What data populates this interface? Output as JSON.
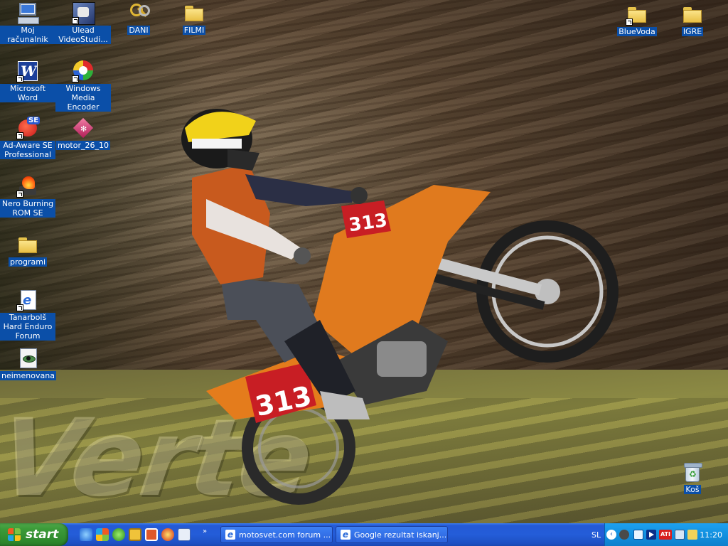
{
  "desktop": {
    "icons_left": [
      {
        "label": "Moj računalnik",
        "icon": "my-computer-icon"
      },
      {
        "label": "Ulead VideoStudi...",
        "icon": "ulead-videostudio-icon",
        "shortcut": true
      },
      {
        "label": "DANI",
        "icon": "keys-icon"
      },
      {
        "label": "FILMI",
        "icon": "folder-icon"
      },
      {
        "label": "Microsoft Word",
        "icon": "word-icon",
        "shortcut": true
      },
      {
        "label": "Windows Media Encoder",
        "icon": "media-encoder-icon",
        "shortcut": true
      },
      {
        "label": "Ad-Aware SE Professional",
        "icon": "adaware-icon",
        "shortcut": true
      },
      {
        "label": "motor_26_10",
        "icon": "image-file-icon"
      },
      {
        "label": "Nero Burning ROM SE",
        "icon": "nero-icon",
        "shortcut": true
      },
      {
        "label": "programi",
        "icon": "folder-icon"
      },
      {
        "label": "Tanarbolš Hard Enduro Forum",
        "icon": "ie-shortcut-icon"
      },
      {
        "label": "neimenovana",
        "icon": "jpeg-file-icon"
      }
    ],
    "icons_right": [
      {
        "label": "BlueVoda",
        "icon": "folder-shortcut-icon",
        "shortcut": true
      },
      {
        "label": "IGRE",
        "icon": "folder-icon"
      },
      {
        "label": "Koš",
        "icon": "recycle-bin-icon"
      }
    ],
    "wallpaper": {
      "plate_number": "313",
      "watermark_text": "Verte"
    }
  },
  "taskbar": {
    "start_label": "start",
    "quicklaunch_more": "»",
    "tasks": [
      {
        "label": "motosvet.com forum ...",
        "icon": "ie-icon"
      },
      {
        "label": "Google rezultat iskanj...",
        "icon": "ie-icon"
      }
    ],
    "language": "SL",
    "clock": "11:20"
  },
  "colors": {
    "taskbar_blue": "#245dd8",
    "start_green": "#3c9b39",
    "tray_blue": "#1291e0",
    "label_highlight": "#0b4fa8"
  }
}
